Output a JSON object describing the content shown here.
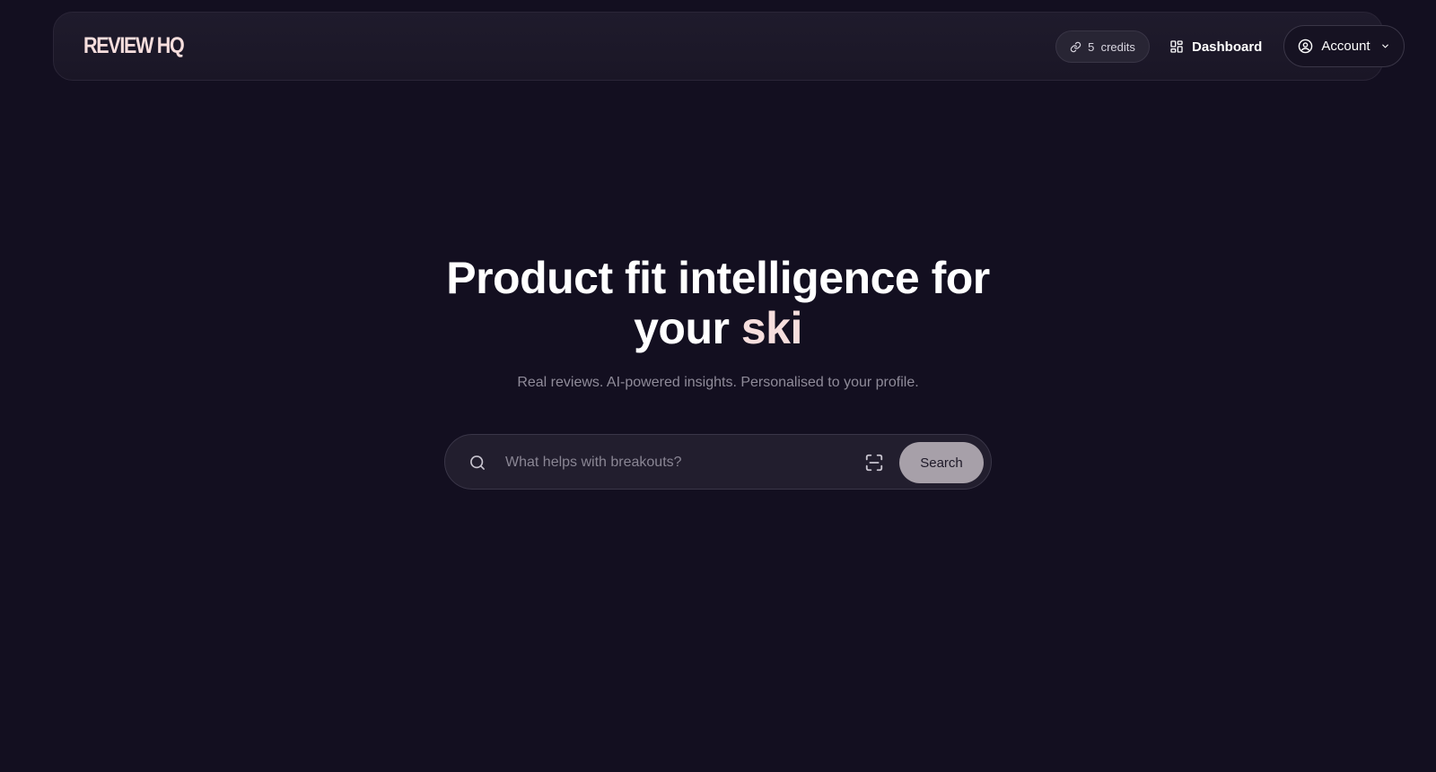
{
  "header": {
    "logo_text": "REVIEW HQ",
    "credits": {
      "label": "5  credits",
      "icon": "link-icon"
    },
    "dashboard": {
      "label": "Dashboard",
      "icon": "grid-icon"
    },
    "account": {
      "label": "Account",
      "icon": "user-circle-icon",
      "chevron_icon": "chevron-down-icon"
    }
  },
  "hero": {
    "title_main": "Product fit intelligence for",
    "title_line2_prefix": "your ",
    "title_accent": "ski",
    "subtitle": "Real reviews. AI-powered insights. Personalised to your profile."
  },
  "search": {
    "placeholder": "What helps with breakouts?",
    "value": "",
    "button_label": "Search",
    "search_icon": "search-icon",
    "scan_icon": "scan-icon"
  },
  "colors": {
    "background": "#130f20",
    "accent": "#f6dedd",
    "search_button": "#a7a0a9"
  }
}
